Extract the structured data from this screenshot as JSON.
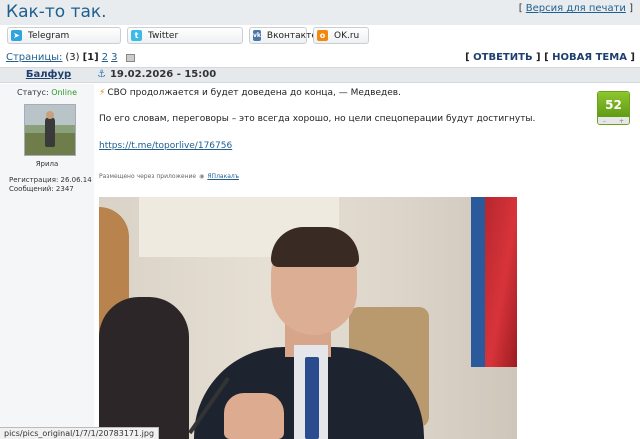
{
  "thread": {
    "title": "Как-то так.",
    "print_version": "Версия для печати"
  },
  "share": {
    "telegram": "Telegram",
    "twitter": "Twitter",
    "vk": "Вконтакте",
    "ok": "OK.ru"
  },
  "pager": {
    "label": "Страницы:",
    "total": "(3)",
    "current": "[1]",
    "page2": "2",
    "page3": "3"
  },
  "topic_actions": {
    "reply": "ОТВЕТИТЬ",
    "new_topic": "НОВАЯ ТЕМА"
  },
  "post": {
    "author": "Балфур",
    "date": "19.02.2026 - 15:00",
    "status_label": "Статус:",
    "status_value": "Online",
    "user_title": "Ярила",
    "registration": "Регистрация: 26.06.14",
    "messages": "Сообщений: 2347",
    "text_line1": "СВО продолжается и будет доведена до конца, — Медведев.",
    "text_line2": "По его словам, переговоры – это всегда хорошо, но цели спецоперации будут достигнуты.",
    "link": "https://t.me/toporlive/176756",
    "app_note": "Размещено через приложение",
    "app_name": "ЯПлакалъ",
    "rating": "52",
    "rating_minus": "–",
    "rating_plus": "+"
  },
  "status_bar": {
    "url": "pics/pics_original/1/7/1/20783171.jpg"
  },
  "colors": {
    "link": "#1f5f8f",
    "online": "#2a9a2a",
    "rating_green": "#6da01f"
  }
}
